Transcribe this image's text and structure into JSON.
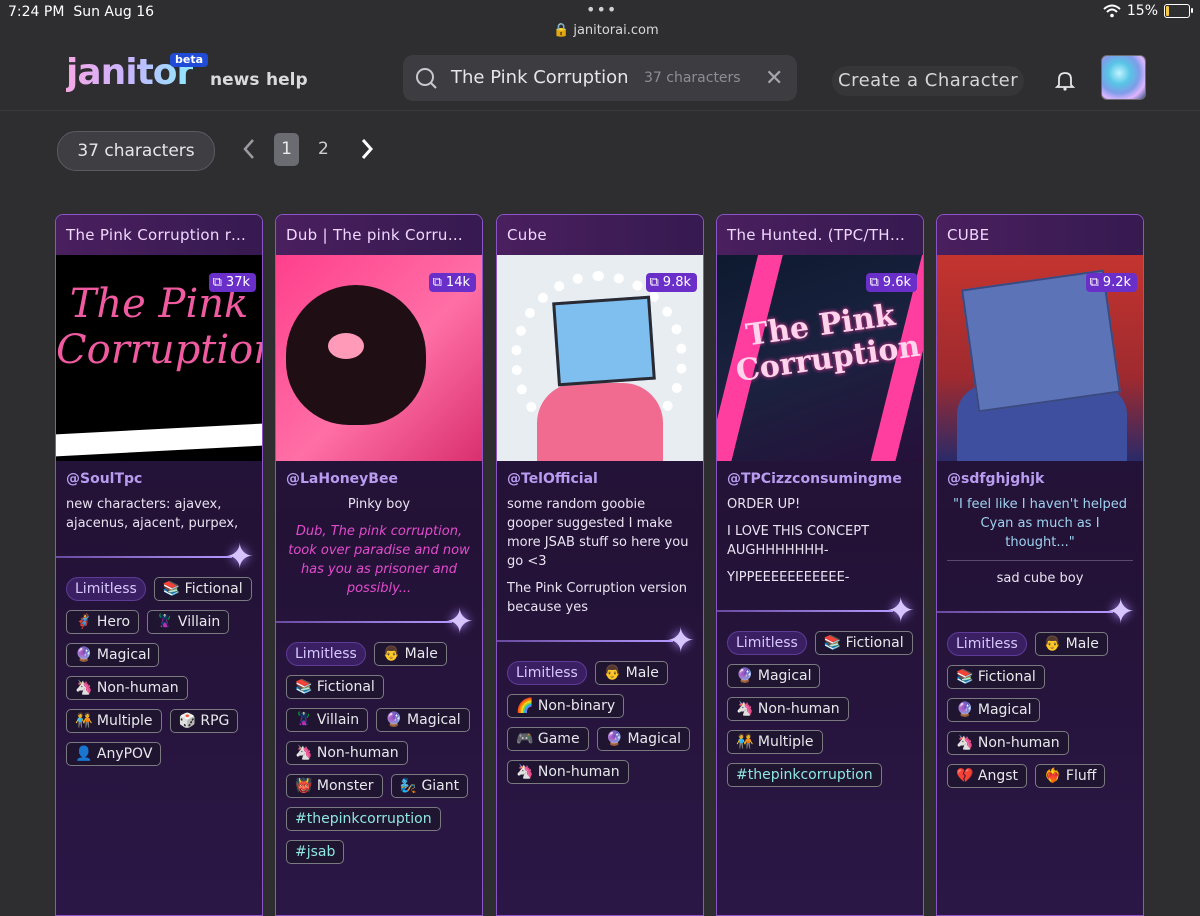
{
  "status_bar": {
    "time": "7:24 PM",
    "date": "Sun Aug 16",
    "url": "janitorai.com",
    "battery": "15%",
    "battery_level": 0.15
  },
  "header": {
    "logo": "janitor",
    "beta": "beta",
    "nav": [
      "news",
      "help"
    ],
    "search": {
      "query": "The Pink Corruption",
      "count": "37 characters"
    },
    "create_label": "Create a Character"
  },
  "toolbar": {
    "character_count": "37 characters",
    "pages": [
      "1",
      "2"
    ],
    "current_page": "1"
  },
  "cards": [
    {
      "title": "The Pink Corruption ro...",
      "chats": "37k",
      "author": "@SoulTpc",
      "thumb_text": "The Pink Corruption",
      "desc": [
        "new characters: ajavex, ajacenus, ajacent, purpex,"
      ],
      "tags": [
        "Limitless",
        "📚 Fictional",
        "🦸 Hero",
        "🦹 Villain",
        "🔮 Magical",
        "🦄 Non-human",
        "🧑‍🤝‍🧑 Multiple",
        "🎲 RPG",
        "👤 AnyPOV"
      ]
    },
    {
      "title": "Dub | The pink Corrupt...",
      "chats": "14k",
      "author": "@LaHoneyBee",
      "desc_center": "Pinky boy",
      "desc_italic": "Dub, The pink corruption, took over paradise and now has you as prisoner and possibly...",
      "tags": [
        "Limitless",
        "👨 Male",
        "📚 Fictional",
        "🦹 Villain",
        "🔮 Magical",
        "🦄 Non-human",
        "👹 Monster",
        "🧞 Giant",
        "#thepinkcorruption",
        "#jsab"
      ]
    },
    {
      "title": "Cube",
      "chats": "9.8k",
      "author": "@TelOfficial",
      "desc": [
        "some random goobie gooper suggested I make more JSAB stuff so here you go <3",
        "The Pink Corruption version because yes"
      ],
      "tags": [
        "Limitless",
        "👨 Male",
        "🌈 Non-binary",
        "🎮 Game",
        "🔮 Magical",
        "🦄 Non-human"
      ]
    },
    {
      "title": "The Hunted. (TPC/THE ...",
      "chats": "9.6k",
      "author": "@TPCizzconsumingme",
      "thumb_text": "The Pink Corruption",
      "desc": [
        "ORDER UP!",
        "I LOVE THIS CONCEPT AUGHHHHHHH-",
        "YIPPEEEEEEEEEEE-"
      ],
      "tags": [
        "Limitless",
        "📚 Fictional",
        "🔮 Magical",
        "🦄 Non-human",
        "🧑‍🤝‍🧑 Multiple",
        "#thepinkcorruption"
      ]
    },
    {
      "title": "CUBE",
      "chats": "9.2k",
      "author": "@sdfghjghjk",
      "desc_quote": "\"I feel like I haven't helped Cyan as much as I thought...\"",
      "desc_center": "sad cube boy",
      "tags": [
        "Limitless",
        "👨 Male",
        "📚 Fictional",
        "🔮 Magical",
        "🦄 Non-human",
        "💔 Angst",
        "❤️‍🔥 Fluff"
      ]
    }
  ],
  "colors": {
    "accent": "#8b55c8",
    "chat_badge": "#6b2fc9",
    "author": "#b99cf0",
    "hashtag": "#8ee7e0"
  }
}
